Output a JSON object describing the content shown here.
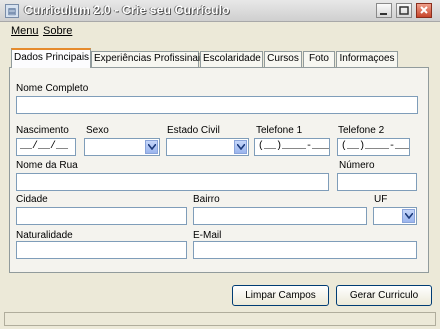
{
  "window": {
    "icon": "document-icon",
    "title": "Curriculum 2.0 - Crie seu Currículo",
    "icons": [
      "minimize-icon",
      "maximize-icon",
      "close-icon"
    ]
  },
  "menu": [
    {
      "label": "Menu"
    },
    {
      "label": "Sobre"
    }
  ],
  "tabs": [
    {
      "label": "Dados Principais"
    },
    {
      "label": "Experiências Profissinais"
    },
    {
      "label": "Escolaridade"
    },
    {
      "label": "Cursos"
    },
    {
      "label": "Foto"
    },
    {
      "label": "Informaçoes"
    }
  ],
  "form": {
    "nome_label": "Nome Completo",
    "nascimento_label": "Nascimento",
    "nascimento_mask": "__/__/__",
    "sexo_label": "Sexo",
    "estado_civil_label": "Estado Civil",
    "telefone1_label": "Telefone 1",
    "telefone1_mask": "(__)____-____",
    "telefone2_label": "Telefone 2",
    "telefone2_mask": "(__)____-____",
    "rua_label": "Nome da Rua",
    "numero_label": "Número",
    "cidade_label": "Cidade",
    "bairro_label": "Bairro",
    "uf_label": "UF",
    "naturalidade_label": "Naturalidade",
    "email_label": "E-Mail"
  },
  "buttons": {
    "limpar": "Limpar Campos",
    "gerar": "Gerar Curriculo"
  }
}
